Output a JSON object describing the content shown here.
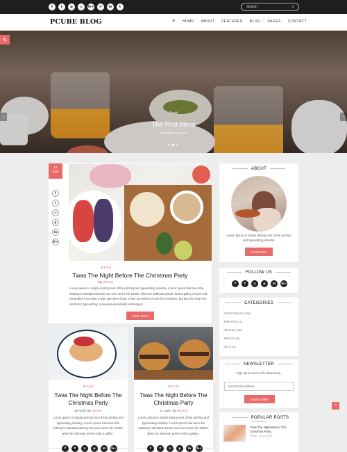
{
  "colors": {
    "accent": "#e86a6a",
    "topbar": "#1e1e1e",
    "page_bg": "#ededed"
  },
  "topbar": {
    "social_icons": [
      "facebook-icon",
      "twitter-icon",
      "pinterest-icon",
      "instagram-icon",
      "google-plus-icon",
      "email-icon",
      "linkedin-icon",
      "tumblr-icon"
    ],
    "social_glyphs": [
      "f",
      "t",
      "p",
      "◎",
      "G+",
      "✉",
      "in",
      "t"
    ],
    "search_placeholder": "Search",
    "search_glyph": "⌕"
  },
  "header": {
    "logo": "PCUBE BLOG",
    "menu_glyph": "≡",
    "nav": [
      "HOME",
      "ABOUT",
      "FEATURES",
      "BLOG",
      "PAGES",
      "CONTACT"
    ]
  },
  "hero": {
    "category": "Food",
    "title": "The First Mess",
    "date": "November 15, 2017",
    "prev_glyph": "‹",
    "next_glyph": "›",
    "corner_glyph": "✎",
    "active_slide": 1,
    "slide_count": 3
  },
  "featured_post": {
    "badge_day": "12",
    "badge_month": "April",
    "share_glyphs": [
      "f",
      "t",
      "◎",
      "p",
      "in",
      "G+"
    ],
    "category_prefix": "In",
    "category": "Food",
    "title": "Twas The Night Before The Christmas Party",
    "by_prefix": "By",
    "author": "dummy",
    "excerpt": "Lorem Ipsum is simply dummy text of the printing and typesetting industry. Lorem Ipsum has been the industry's standard dummy text ever since the 1500s, when an unknown printer took a galley of type and scrambled it to make a type specimen book. It has survived not only five centuries, but also the leap into electronic typesetting, remaining essentially unchanged.",
    "read_more": "Read More"
  },
  "small_posts": [
    {
      "category_prefix": "In",
      "category": "Food",
      "title": "Twas The Night Before The Christmas Party",
      "date": "12 April",
      "by": "By",
      "author": "dummy",
      "excerpt": "Lorem Ipsum is simply dummy text of the printing and typesetting industry. Lorem Ipsum has been the industry's standard dummy text ever since the 1500s, when an unknown printer took a galley ."
    },
    {
      "category_prefix": "In",
      "category": "Food",
      "title": "Twas The Night Before The Christmas Party",
      "date": "12 April",
      "by": "By",
      "author": "dummy",
      "excerpt": "Lorem Ipsum is simply dummy text of the printing and typesetting industry. Lorem Ipsum has been the industry's standard dummy text ever since the 1500s, when an unknown printer took a galley ."
    }
  ],
  "sidebar": {
    "about": {
      "title": "ABOUT",
      "text": "Lorem Ipsum is simply dummy text of the printing and typesetting industry.",
      "button": "Read More"
    },
    "follow": {
      "title": "FOLLOW US",
      "glyphs": [
        "f",
        "t",
        "◎",
        "p",
        "in",
        "G+"
      ]
    },
    "categories": {
      "title": "CATEGORIES",
      "items": [
        "VEGETABLES (25)",
        "PROTEIN (7)",
        "GRAINS (12)",
        "FRUITS (9)",
        "OILS (5)"
      ]
    },
    "newsletter": {
      "title": "NEWSLETTER",
      "subtitle": "Sign up to receive the latest story.",
      "placeholder": "Your Email Address",
      "button": "SUBSCRIBE"
    },
    "popular": {
      "title": "POPULAR POSTS",
      "post_title": "Twas The Night Before The Christmas Party",
      "post_category": "FOOD",
      "post_date": "22-11-2017"
    }
  },
  "back_to_top_glyph": "^"
}
